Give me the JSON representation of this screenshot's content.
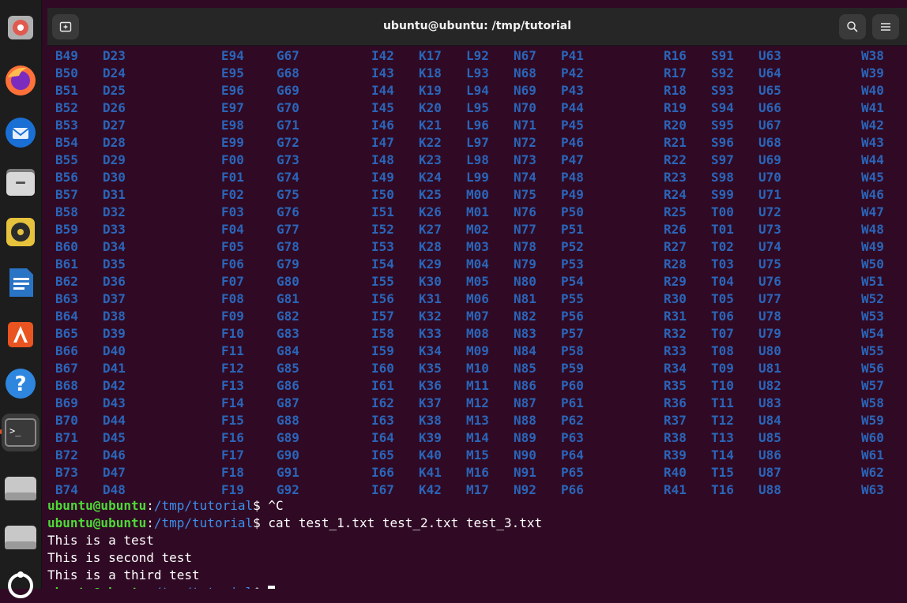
{
  "window": {
    "title": "ubuntu@ubuntu: /tmp/tutorial"
  },
  "dock": {
    "items": [
      {
        "name": "disk-usage-icon"
      },
      {
        "name": "firefox-icon"
      },
      {
        "name": "thunderbird-icon"
      },
      {
        "name": "files-icon"
      },
      {
        "name": "rhythmbox-icon"
      },
      {
        "name": "writer-icon"
      },
      {
        "name": "app-center-icon"
      },
      {
        "name": "help-icon"
      },
      {
        "name": "terminal-icon"
      },
      {
        "name": "drive-icon"
      },
      {
        "name": "drive-icon-2"
      },
      {
        "name": "ubuntu-icon"
      }
    ]
  },
  "grid": {
    "columns": [
      [
        "B49",
        "B50",
        "B51",
        "B52",
        "B53",
        "B54",
        "B55",
        "B56",
        "B57",
        "B58",
        "B59",
        "B60",
        "B61",
        "B62",
        "B63",
        "B64",
        "B65",
        "B66",
        "B67",
        "B68",
        "B69",
        "B70",
        "B71",
        "B72",
        "B73",
        "B74"
      ],
      [
        "D23",
        "D24",
        "D25",
        "D26",
        "D27",
        "D28",
        "D29",
        "D30",
        "D31",
        "D32",
        "D33",
        "D34",
        "D35",
        "D36",
        "D37",
        "D38",
        "D39",
        "D40",
        "D41",
        "D42",
        "D43",
        "D44",
        "D45",
        "D46",
        "D47",
        "D48"
      ],
      [
        "E94",
        "E95",
        "E96",
        "E97",
        "E98",
        "E99",
        "F00",
        "F01",
        "F02",
        "F03",
        "F04",
        "F05",
        "F06",
        "F07",
        "F08",
        "F09",
        "F10",
        "F11",
        "F12",
        "F13",
        "F14",
        "F15",
        "F16",
        "F17",
        "F18",
        "F19"
      ],
      [
        "G67",
        "G68",
        "G69",
        "G70",
        "G71",
        "G72",
        "G73",
        "G74",
        "G75",
        "G76",
        "G77",
        "G78",
        "G79",
        "G80",
        "G81",
        "G82",
        "G83",
        "G84",
        "G85",
        "G86",
        "G87",
        "G88",
        "G89",
        "G90",
        "G91",
        "G92"
      ],
      [
        "I42",
        "I43",
        "I44",
        "I45",
        "I46",
        "I47",
        "I48",
        "I49",
        "I50",
        "I51",
        "I52",
        "I53",
        "I54",
        "I55",
        "I56",
        "I57",
        "I58",
        "I59",
        "I60",
        "I61",
        "I62",
        "I63",
        "I64",
        "I65",
        "I66",
        "I67"
      ],
      [
        "K17",
        "K18",
        "K19",
        "K20",
        "K21",
        "K22",
        "K23",
        "K24",
        "K25",
        "K26",
        "K27",
        "K28",
        "K29",
        "K30",
        "K31",
        "K32",
        "K33",
        "K34",
        "K35",
        "K36",
        "K37",
        "K38",
        "K39",
        "K40",
        "K41",
        "K42"
      ],
      [
        "L92",
        "L93",
        "L94",
        "L95",
        "L96",
        "L97",
        "L98",
        "L99",
        "M00",
        "M01",
        "M02",
        "M03",
        "M04",
        "M05",
        "M06",
        "M07",
        "M08",
        "M09",
        "M10",
        "M11",
        "M12",
        "M13",
        "M14",
        "M15",
        "M16",
        "M17"
      ],
      [
        "N67",
        "N68",
        "N69",
        "N70",
        "N71",
        "N72",
        "N73",
        "N74",
        "N75",
        "N76",
        "N77",
        "N78",
        "N79",
        "N80",
        "N81",
        "N82",
        "N83",
        "N84",
        "N85",
        "N86",
        "N87",
        "N88",
        "N89",
        "N90",
        "N91",
        "N92"
      ],
      [
        "P41",
        "P42",
        "P43",
        "P44",
        "P45",
        "P46",
        "P47",
        "P48",
        "P49",
        "P50",
        "P51",
        "P52",
        "P53",
        "P54",
        "P55",
        "P56",
        "P57",
        "P58",
        "P59",
        "P60",
        "P61",
        "P62",
        "P63",
        "P64",
        "P65",
        "P66"
      ],
      [
        "R16",
        "R17",
        "R18",
        "R19",
        "R20",
        "R21",
        "R22",
        "R23",
        "R24",
        "R25",
        "R26",
        "R27",
        "R28",
        "R29",
        "R30",
        "R31",
        "R32",
        "R33",
        "R34",
        "R35",
        "R36",
        "R37",
        "R38",
        "R39",
        "R40",
        "R41"
      ],
      [
        "S91",
        "S92",
        "S93",
        "S94",
        "S95",
        "S96",
        "S97",
        "S98",
        "S99",
        "T00",
        "T01",
        "T02",
        "T03",
        "T04",
        "T05",
        "T06",
        "T07",
        "T08",
        "T09",
        "T10",
        "T11",
        "T12",
        "T13",
        "T14",
        "T15",
        "T16"
      ],
      [
        "U63",
        "U64",
        "U65",
        "U66",
        "U67",
        "U68",
        "U69",
        "U70",
        "U71",
        "U72",
        "U73",
        "U74",
        "U75",
        "U76",
        "U77",
        "U78",
        "U79",
        "U80",
        "U81",
        "U82",
        "U83",
        "U84",
        "U85",
        "U86",
        "U87",
        "U88"
      ],
      [
        "W38",
        "W39",
        "W40",
        "W41",
        "W42",
        "W43",
        "W44",
        "W45",
        "W46",
        "W47",
        "W48",
        "W49",
        "W50",
        "W51",
        "W52",
        "W53",
        "W54",
        "W55",
        "W56",
        "W57",
        "W58",
        "W59",
        "W60",
        "W61",
        "W62",
        "W63"
      ]
    ]
  },
  "prompt": {
    "user": "ubuntu@ubuntu",
    "path": "/tmp/tutorial",
    "symbol": "$"
  },
  "lines": {
    "cmd1": " ^C",
    "cmd2": " cat test_1.txt test_2.txt test_3.txt",
    "out1": "This is a test",
    "out2": "This is second test",
    "out3": "This is a third test"
  },
  "colors": {
    "background": "#300a24",
    "grid_text": "#2a65b9",
    "prompt_user": "#4ed938",
    "prompt_path": "#3b8eea"
  }
}
